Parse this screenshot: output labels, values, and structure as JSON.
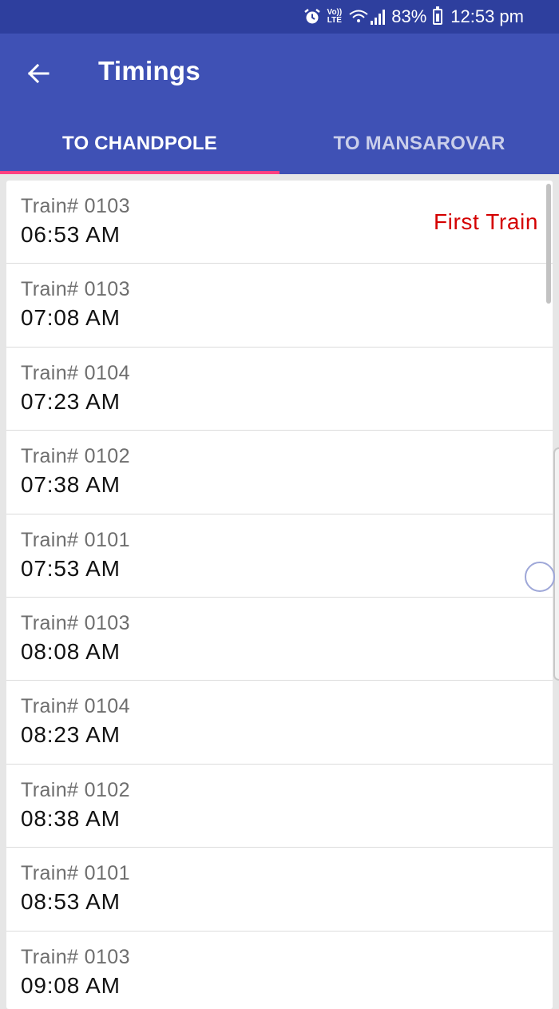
{
  "status_bar": {
    "alarm_icon": "alarm-icon",
    "lte_top": "Vo))",
    "lte_bottom": "LTE",
    "signal_icon": "signal-icon",
    "battery_percent": "83%",
    "time": "12:53 pm"
  },
  "app_bar": {
    "back_icon": "arrow-left-icon",
    "title": "Timings",
    "color": "#3f51b5"
  },
  "tabs": [
    {
      "label": "TO CHANDPOLE",
      "active": true
    },
    {
      "label": "TO MANSAROVAR",
      "active": false
    }
  ],
  "accent_color": "#ff4081",
  "trains": [
    {
      "train": "Train# 0103",
      "time": "06:53 AM",
      "tag": "First Train"
    },
    {
      "train": "Train# 0103",
      "time": "07:08 AM",
      "tag": ""
    },
    {
      "train": "Train# 0104",
      "time": "07:23 AM",
      "tag": ""
    },
    {
      "train": "Train# 0102",
      "time": "07:38 AM",
      "tag": ""
    },
    {
      "train": "Train# 0101",
      "time": "07:53 AM",
      "tag": ""
    },
    {
      "train": "Train# 0103",
      "time": "08:08 AM",
      "tag": ""
    },
    {
      "train": "Train# 0104",
      "time": "08:23 AM",
      "tag": ""
    },
    {
      "train": "Train# 0102",
      "time": "08:38 AM",
      "tag": ""
    },
    {
      "train": "Train# 0101",
      "time": "08:53 AM",
      "tag": ""
    },
    {
      "train": "Train# 0103",
      "time": "09:08 AM",
      "tag": ""
    }
  ]
}
